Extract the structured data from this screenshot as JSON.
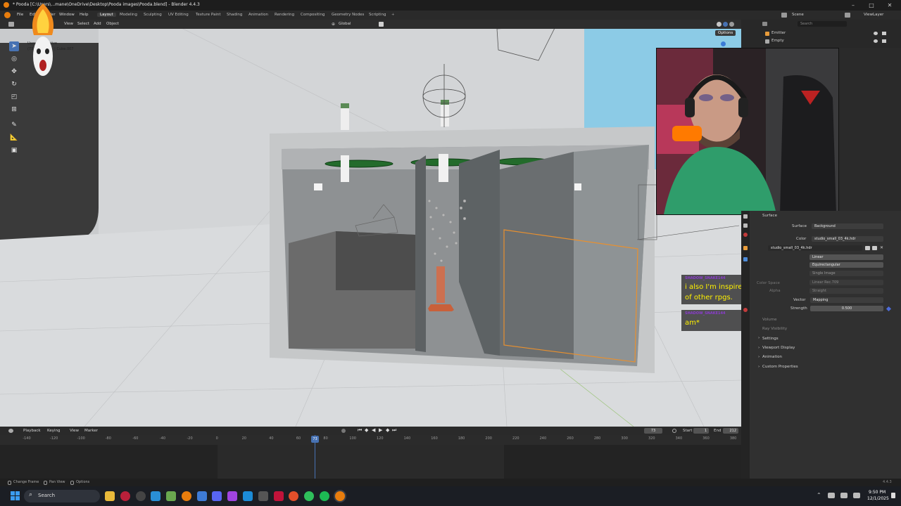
{
  "window": {
    "title": "* Pooda [C:\\Users\\...mane\\OneDrive\\Desktop\\Pooda images\\Pooda.blend] - Blender 4.4.3",
    "minimize": "–",
    "maximize": "□",
    "close": "✕"
  },
  "menus": [
    "File",
    "Edit",
    "Render",
    "Window",
    "Help"
  ],
  "workspaces": [
    "Layout",
    "Modeling",
    "Sculpting",
    "UV Editing",
    "Texture Paint",
    "Shading",
    "Animation",
    "Rendering",
    "Compositing",
    "Geometry Nodes",
    "Scripting"
  ],
  "active_workspace": "Layout",
  "scene": {
    "name": "Scene",
    "view_layer": "ViewLayer"
  },
  "viewport_header": {
    "menus": [
      "View",
      "Select",
      "Add",
      "Object"
    ],
    "orientation": "Global",
    "options_label": "Options"
  },
  "viewport_overlay": {
    "line1": "User Perspective",
    "line2": "(73) Collection | Cube.007"
  },
  "outliner": {
    "search_placeholder": "Search",
    "items": [
      "Emitter",
      "Empty"
    ]
  },
  "properties": {
    "surface_header": "Surface",
    "surface_label": "Surface",
    "surface_value": "Background",
    "color_label": "Color",
    "color_value": "studio_small_03_4k.hdr",
    "image_name": "studio_small_03_4k.hdr",
    "interpolation": "Linear",
    "projection": "Equirectangular",
    "source": "Single Image",
    "color_space_label": "Color Space",
    "color_space_value": "Linear Rec.709",
    "alpha_label": "Alpha",
    "alpha_value": "Straight",
    "vector_label": "Vector",
    "vector_value": "Mapping",
    "strength_label": "Strength",
    "strength_value": "0.500",
    "volume": "Volume",
    "ray_visibility": "Ray Visibility",
    "sections": [
      "Settings",
      "Viewport Display",
      "Animation",
      "Custom Properties"
    ]
  },
  "chat": [
    {
      "user": "SHADOW_SNAKE144",
      "message": "i also I'm inspired by Baldur's gate, Witcher and plenty of other rpgs."
    },
    {
      "user": "SHADOW_SNAKE144",
      "message": "am*"
    }
  ],
  "timeline": {
    "menus": [
      "Playback",
      "Keying",
      "View",
      "Marker"
    ],
    "current_frame": "73",
    "start_label": "Start",
    "start_value": "1",
    "end_label": "End",
    "end_value": "212",
    "ticks": [
      "-140",
      "-120",
      "-100",
      "-80",
      "-60",
      "-40",
      "-20",
      "0",
      "20",
      "40",
      "60",
      "80",
      "100",
      "120",
      "140",
      "160",
      "180",
      "200",
      "220",
      "240",
      "260",
      "280",
      "300",
      "320",
      "340",
      "360",
      "380"
    ],
    "playhead_label": "73"
  },
  "statusbar": {
    "items": [
      "Change Frame",
      "Pan View",
      "Options"
    ],
    "version": "4.4.3"
  },
  "taskbar": {
    "search_placeholder": "Search",
    "time": "9:50 PM",
    "date": "12/1/2025"
  },
  "colors": {
    "accent": "#4772b3",
    "chat_text": "#fff200",
    "chat_name": "#8c3ccf",
    "selection_outline": "#e8902f"
  }
}
